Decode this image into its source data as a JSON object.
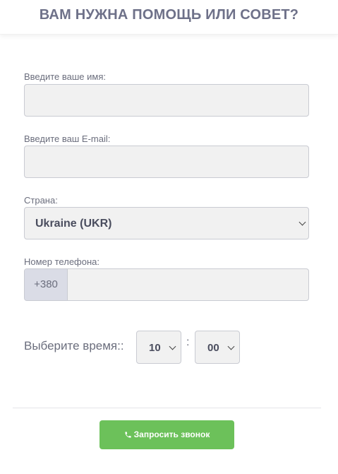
{
  "header": {
    "title": "ВАМ НУЖНА ПОМОЩЬ ИЛИ СОВЕТ?"
  },
  "form": {
    "name": {
      "label": "Введите ваше имя:",
      "value": ""
    },
    "email": {
      "label": "Введите ваш E-mail:",
      "value": ""
    },
    "country": {
      "label": "Страна:",
      "selected": "Ukraine (UKR)"
    },
    "phone": {
      "label": "Номер телефона:",
      "prefix": "+380",
      "value": ""
    },
    "time": {
      "label": "Выберите время::",
      "hour": "10",
      "separator": ":",
      "minute": "00"
    },
    "submit": {
      "label": "Запросить звонок",
      "icon": "phone-icon",
      "color": "#6cc15a"
    }
  }
}
